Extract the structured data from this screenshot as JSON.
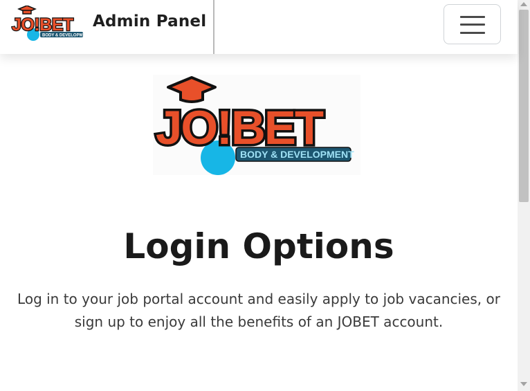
{
  "navbar": {
    "brand_logo_text": "JO!BET",
    "brand_logo_subtext": "BODY & DEVELOPMENT",
    "title": "Admin Panel",
    "menu_toggle": "hamburger-menu-icon"
  },
  "hero": {
    "logo_text": "JO!BET",
    "logo_subtext": "BODY & DEVELOPMENT"
  },
  "main": {
    "title": "Login Options",
    "description": "Log in to your job portal account and easily apply to job vacancies, or sign up to enjoy all the benefits of an JOBET account."
  },
  "colors": {
    "logo_orange": "#e8502a",
    "logo_outline": "#111111",
    "logo_blue": "#17b6e6",
    "logo_teal": "#1c5670",
    "text_dark": "#1a1a1a"
  }
}
